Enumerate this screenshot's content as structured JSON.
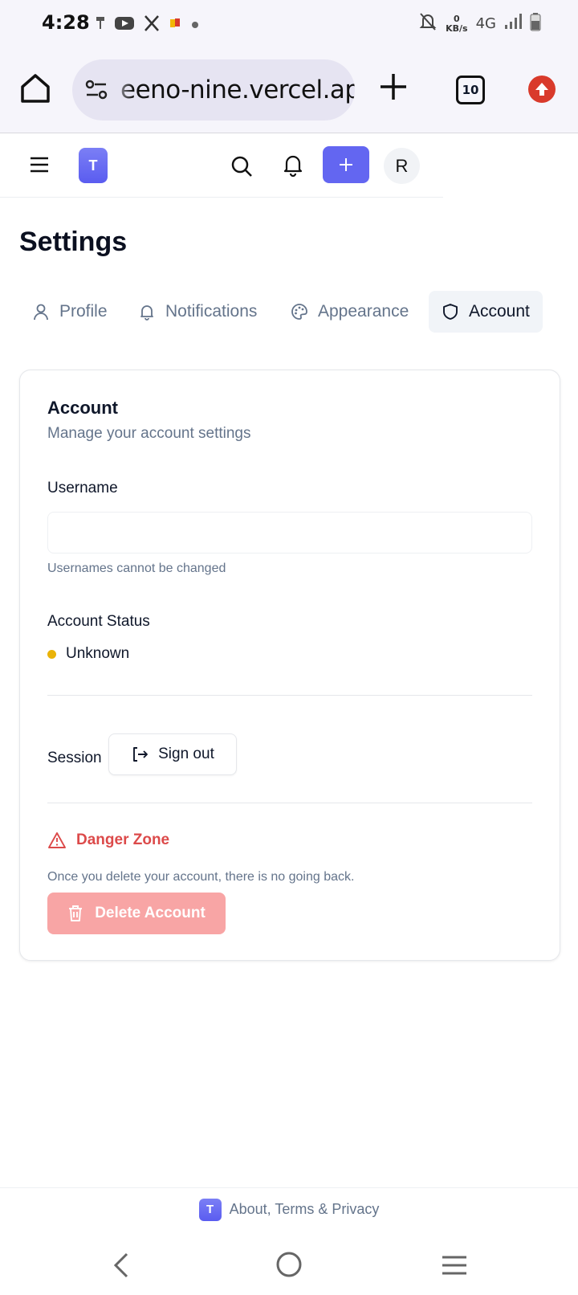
{
  "status_bar": {
    "time": "4:28",
    "net_speed_value": "0",
    "net_speed_unit": "KB/s",
    "network": "4G"
  },
  "browser": {
    "url": "eeno-nine.vercel.app",
    "tab_count": "10",
    "accent_color": "#d93a2b"
  },
  "app_header": {
    "logo_letter": "T",
    "avatar_letter": "R",
    "brand_color": "#6366f1"
  },
  "page": {
    "title": "Settings"
  },
  "tabs": [
    {
      "label": "Profile",
      "icon": "user-icon",
      "active": false
    },
    {
      "label": "Notifications",
      "icon": "bell-icon",
      "active": false
    },
    {
      "label": "Appearance",
      "icon": "palette-icon",
      "active": false
    },
    {
      "label": "Account",
      "icon": "shield-icon",
      "active": true
    }
  ],
  "account_card": {
    "title": "Account",
    "description": "Manage your account settings",
    "username_label": "Username",
    "username_value": "",
    "username_hint": "Usernames cannot be changed",
    "status_label": "Account Status",
    "status_value": "Unknown",
    "status_color": "#eab308",
    "session_label": "Session",
    "signout_label": "Sign out",
    "danger_title": "Danger Zone",
    "danger_description": "Once you delete your account, there is no going back.",
    "delete_label": "Delete Account",
    "danger_color": "#dc4a4a"
  },
  "footer": {
    "logo_letter": "T",
    "text": "About, Terms & Privacy"
  }
}
